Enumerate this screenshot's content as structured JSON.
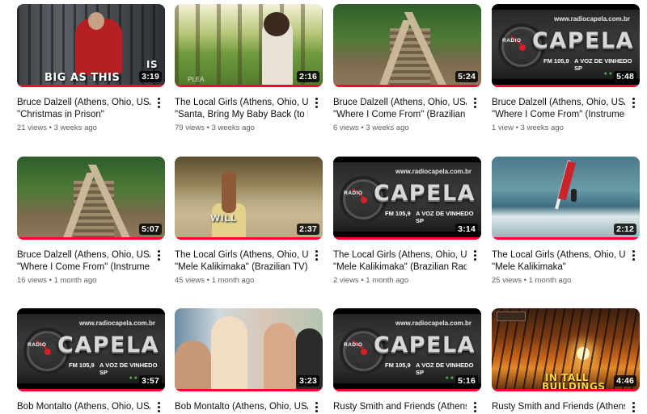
{
  "videos": [
    {
      "title_1": "Bruce Dalzell (Athens, Ohio, USA):",
      "title_2": "\"Christmas in Prison\"",
      "views": "21 views",
      "age": "3 weeks ago",
      "duration": "3:19",
      "overlay": "BIG AS THIS",
      "overlay_2": "IS"
    },
    {
      "title_1": "The Local Girls (Athens, Ohio, USA):",
      "title_2": "\"Santa, Bring My Baby Back (to Me)\"",
      "views": "79 views",
      "age": "3 weeks ago",
      "duration": "2:16",
      "overlay": "PLEA"
    },
    {
      "title_1": "Bruce Dalzell (Athens, Ohio, USA):",
      "title_2": "\"Where I Come From\" (Brazilian TV)",
      "views": "6 views",
      "age": "3 weeks ago",
      "duration": "5:24"
    },
    {
      "title_1": "Bruce Dalzell (Athens, Ohio, USA):",
      "title_2": "\"Where I Come From\" (Instrumenta",
      "views": "1 view",
      "age": "3 weeks ago",
      "duration": "5:48"
    },
    {
      "title_1": "Bruce Dalzell (Athens, Ohio, USA):",
      "title_2": "\"Where I Come From\" (Instrumental)",
      "views": "16 views",
      "age": "1 month ago",
      "duration": "5:07"
    },
    {
      "title_1": "The Local Girls (Athens, Ohio, USA):",
      "title_2": "\"Mele Kalikimaka\" (Brazilian TV)",
      "views": "45 views",
      "age": "1 month ago",
      "duration": "2:37",
      "overlay": "WILL"
    },
    {
      "title_1": "The Local Girls (Athens, Ohio, USA):",
      "title_2": "\"Mele Kalikimaka\" (Brazilian Radio)",
      "views": "2 views",
      "age": "1 month ago",
      "duration": "3:14"
    },
    {
      "title_1": "The Local Girls (Athens, Ohio, USA):",
      "title_2": "\"Mele Kalikimaka\"",
      "views": "25 views",
      "age": "1 month ago",
      "duration": "2:12"
    },
    {
      "title_1": "Bob Montalto (Athens, Ohio, USA):",
      "duration": "3:57"
    },
    {
      "title_1": "Bob Montalto (Athens, Ohio, USA):",
      "duration": "3:23"
    },
    {
      "title_1": "Rusty Smith and Friends (Athens,",
      "duration": "5:16"
    },
    {
      "title_1": "Rusty Smith and Friends (Athens,",
      "duration": "4:46",
      "overlay": "IN TALL",
      "overlay_2": "BUILDINGS"
    }
  ],
  "radio_capela": {
    "url": "www.radiocapela.com.br",
    "brand": "CAPELA",
    "radio": "RADIO",
    "freq": "FM 105,9",
    "slogan": "A VOZ DE VINHEDO SP"
  },
  "colors": {
    "progress_bar": "#ff0033",
    "title_text": "#0f0f0f",
    "meta_text": "#606060"
  },
  "icons": {
    "menu": "more-vert-icon"
  }
}
